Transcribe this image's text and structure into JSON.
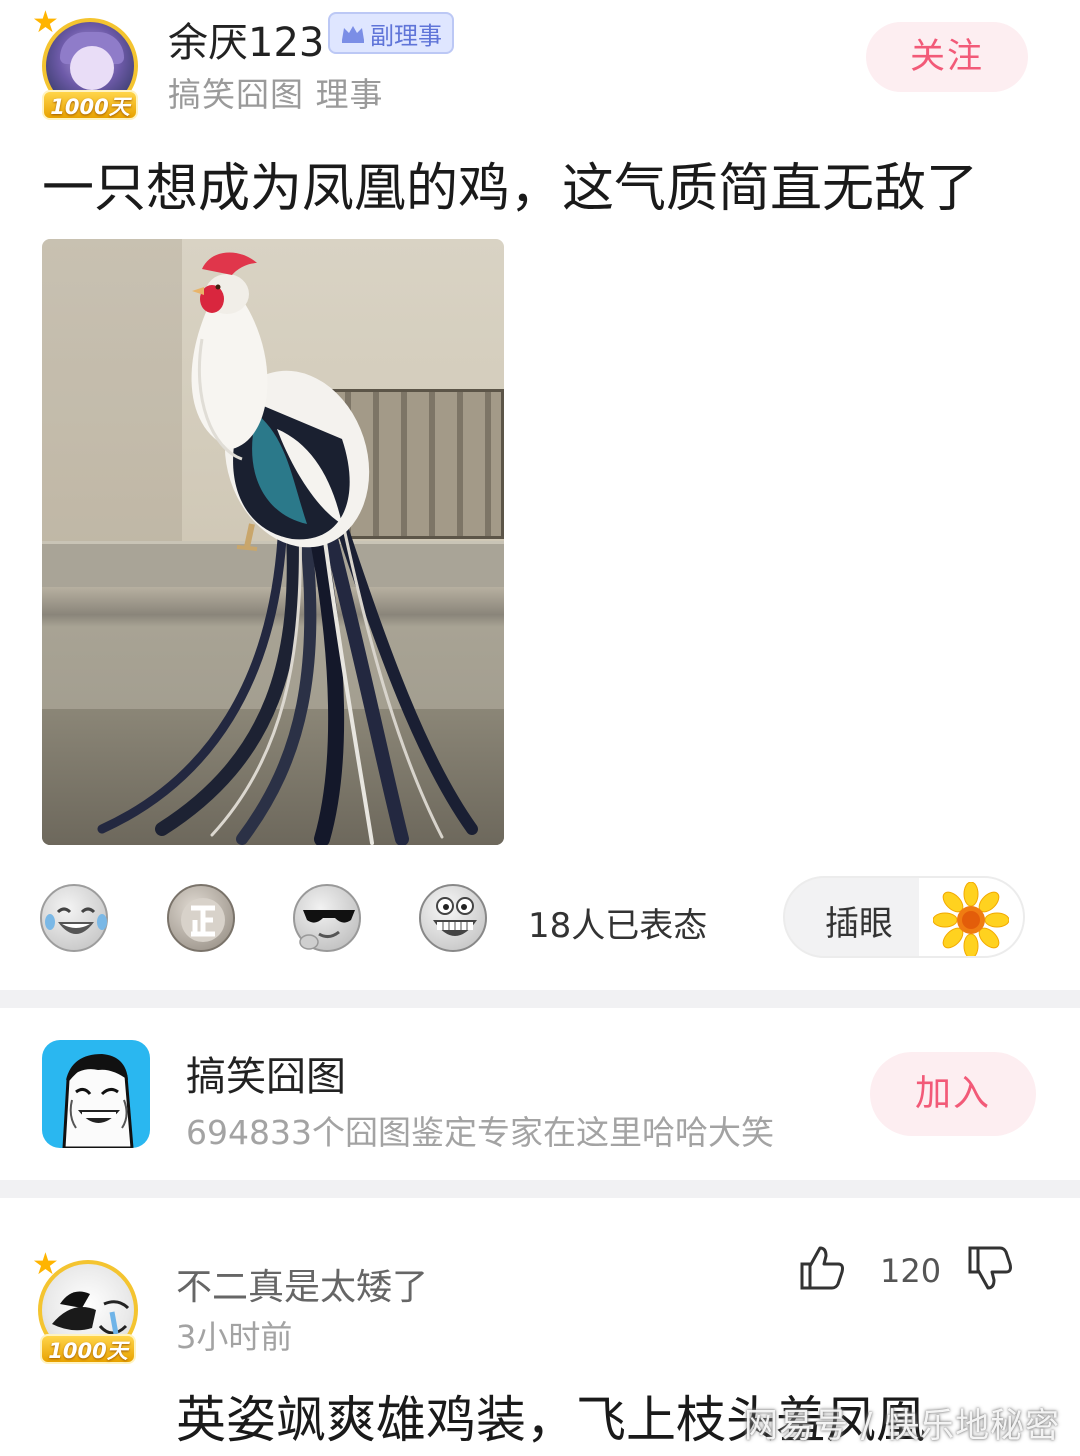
{
  "post": {
    "username": "余厌123",
    "role_badge": "副理事",
    "group_line": "搞笑囧图 理事",
    "follow_label": "关注",
    "avatar_badge": "1000天",
    "title": "一只想成为凤凰的鸡，这气质简直无敌了"
  },
  "reactions": {
    "emojis": [
      "laughing-tears",
      "zheng",
      "cool-sunglasses",
      "big-grin"
    ],
    "count_text": "18人已表态",
    "poke_label": "插眼"
  },
  "group": {
    "name": "搞笑囧图",
    "description": "694833个囧图鉴定专家在这里哈哈大笑",
    "join_label": "加入"
  },
  "comment": {
    "username": "不二真是太矮了",
    "time": "3小时前",
    "avatar_badge": "1000天",
    "like_count": "120",
    "text": "英姿飒爽雄鸡装，飞上枝头羞凤凰"
  },
  "watermark": "网易号 / 快乐地秘密",
  "colors": {
    "accent_pink": "#f25a78",
    "pink_bg": "#fdeef1",
    "badge_blue": "#5f74d8",
    "group_logo_blue": "#2ab7f0"
  }
}
